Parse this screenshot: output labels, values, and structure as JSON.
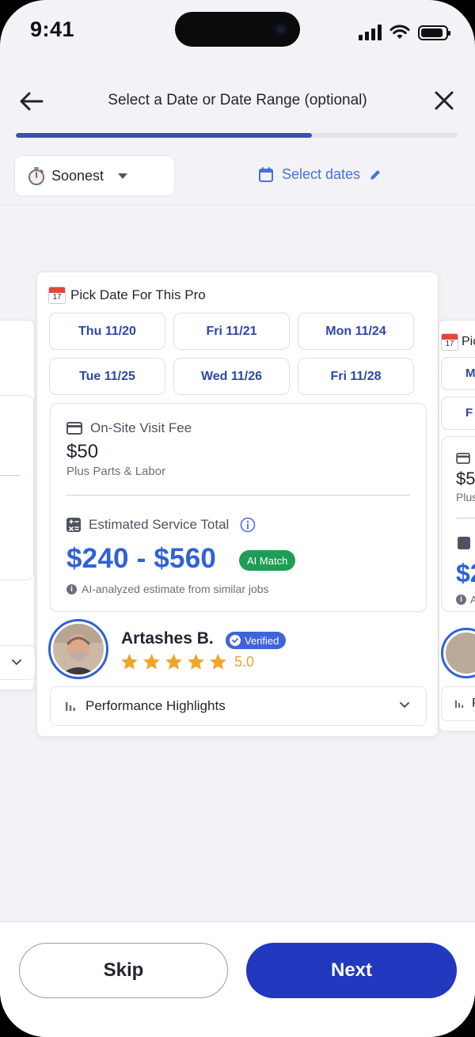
{
  "status_bar": {
    "time": "9:41"
  },
  "header": {
    "title": "Select a Date or Date Range (optional)"
  },
  "progress": {
    "fraction": 0.67
  },
  "filters": {
    "sort_label": "Soonest",
    "select_dates_label": "Select dates"
  },
  "main_card": {
    "pick_title": "Pick Date For This Pro",
    "calendar_emoji_day": "17",
    "dates": [
      "Thu 11/20",
      "Fri 11/21",
      "Mon 11/24",
      "Tue 11/25",
      "Wed 11/26",
      "Fri 11/28"
    ],
    "fee_label": "On-Site Visit Fee",
    "fee_amount": "$50",
    "fee_sub": "Plus Parts & Labor",
    "estimate_label": "Estimated Service Total",
    "estimate_total": "$240 - $560",
    "ai_badge": "AI Match",
    "estimate_note": "AI-analyzed estimate from similar jobs",
    "pro_name": "Artashes B.",
    "verified_label": "Verified",
    "rating": "5.0",
    "star_count": 5,
    "performance_label": "Performance Highlights"
  },
  "side_card_right": {
    "pick_title": "Pic",
    "chip_1": "Mo",
    "chip_2": "F",
    "fee_amount": "$5",
    "fee_sub": "Plus",
    "est_fragment": "$2",
    "note_fragment": "A",
    "perf_fragment": "P"
  },
  "footer": {
    "skip_label": "Skip",
    "next_label": "Next"
  },
  "colors": {
    "primary": "#2238bf",
    "accent_blue": "#2f62d6",
    "ai_green": "#1f9d55",
    "star": "#f0a52e",
    "progress": "#3d4fb4"
  }
}
